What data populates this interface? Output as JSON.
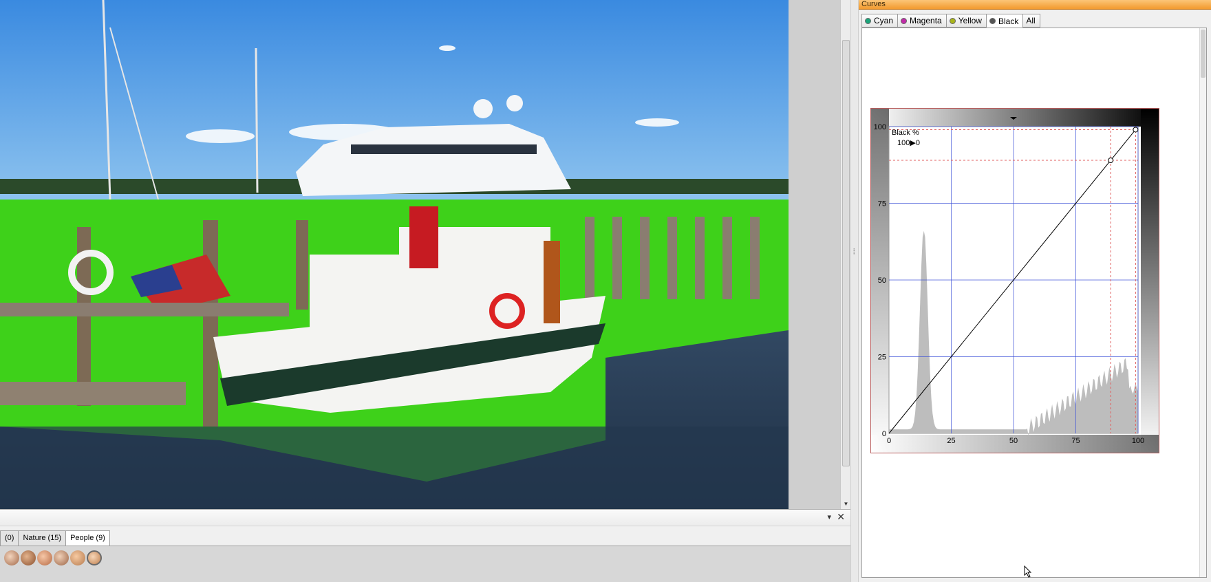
{
  "panel": {
    "title": "Curves"
  },
  "channel_tabs": [
    {
      "label": "Cyan",
      "color": "#1aa57a"
    },
    {
      "label": "Magenta",
      "color": "#c12aa8"
    },
    {
      "label": "Yellow",
      "color": "#a9b41a"
    },
    {
      "label": "Black",
      "color": "#555555"
    },
    {
      "label": "All",
      "color": ""
    }
  ],
  "active_channel": "Black",
  "curve": {
    "channel_label": "Black %",
    "readout": "100▶0",
    "x_ticks": [
      "0",
      "25",
      "50",
      "75",
      "100"
    ],
    "y_ticks": [
      "0",
      "25",
      "50",
      "75",
      "100"
    ],
    "points": [
      [
        0,
        0
      ],
      [
        89,
        89
      ],
      [
        99,
        99
      ]
    ],
    "grid_color": "#3a4fd8",
    "guide_color": "#e06060"
  },
  "library": {
    "tabs": [
      {
        "label": "(0)"
      },
      {
        "label": "Nature (15)"
      },
      {
        "label": "People (9)"
      }
    ],
    "active_tab": "People (9)",
    "pin_icon": "pin-icon",
    "close_icon": "close-icon",
    "close_glyph": "✕",
    "pin_glyph": "▾"
  },
  "highlight_color": "#3ed11a"
}
